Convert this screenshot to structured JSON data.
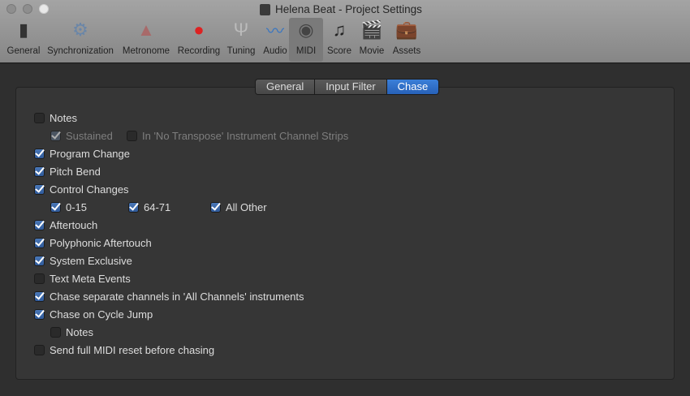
{
  "window": {
    "title": "Helena Beat - Project Settings"
  },
  "toolbar": [
    {
      "label": "General",
      "icon": "switch-icon"
    },
    {
      "label": "Synchronization",
      "icon": "gears-icon"
    },
    {
      "label": "Metronome",
      "icon": "metronome-icon"
    },
    {
      "label": "Recording",
      "icon": "record-icon"
    },
    {
      "label": "Tuning",
      "icon": "tuning-fork-icon"
    },
    {
      "label": "Audio",
      "icon": "waveform-icon"
    },
    {
      "label": "MIDI",
      "icon": "midi-port-icon",
      "selected": true
    },
    {
      "label": "Score",
      "icon": "music-notes-icon"
    },
    {
      "label": "Movie",
      "icon": "clapperboard-icon"
    },
    {
      "label": "Assets",
      "icon": "briefcase-icon"
    }
  ],
  "tabs": [
    {
      "label": "General"
    },
    {
      "label": "Input Filter"
    },
    {
      "label": "Chase",
      "selected": true
    }
  ],
  "options": [
    {
      "label": "Notes",
      "checked": false
    },
    {
      "label": "Sustained",
      "checked": true,
      "disabled": true
    },
    {
      "label": "In 'No Transpose' Instrument Channel Strips",
      "checked": false,
      "disabled": true
    },
    {
      "label": "Program Change",
      "checked": true
    },
    {
      "label": "Pitch Bend",
      "checked": true
    },
    {
      "label": "Control Changes",
      "checked": true
    },
    {
      "label": "0-15",
      "checked": true
    },
    {
      "label": "64-71",
      "checked": true
    },
    {
      "label": "All Other",
      "checked": true
    },
    {
      "label": "Aftertouch",
      "checked": true
    },
    {
      "label": "Polyphonic Aftertouch",
      "checked": true
    },
    {
      "label": "System Exclusive",
      "checked": true
    },
    {
      "label": "Text Meta Events",
      "checked": false
    },
    {
      "label": "Chase separate channels in 'All Channels' instruments",
      "checked": true
    },
    {
      "label": "Chase on Cycle Jump",
      "checked": true
    },
    {
      "label": "Notes",
      "checked": false
    },
    {
      "label": "Send full MIDI reset before chasing",
      "checked": false
    }
  ],
  "colors": {
    "accent": "#2f6cc8"
  }
}
